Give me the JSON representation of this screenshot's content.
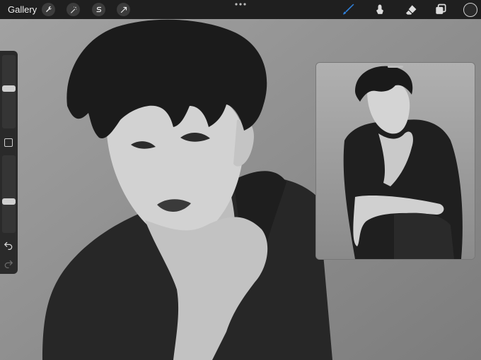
{
  "toolbar": {
    "gallery_label": "Gallery",
    "left_tools": [
      "wrench-icon",
      "magic-wand-icon",
      "selection-s-icon",
      "transform-arrow-icon"
    ],
    "right_tools": [
      "brush-icon",
      "smudge-icon",
      "eraser-icon",
      "layers-icon"
    ],
    "active_tool": "brush-icon",
    "accent_color": "#2f7fd8",
    "current_color": "#2a2a2a"
  },
  "sidebar": {
    "brush_size_level": 0.55,
    "opacity_level": 0.4,
    "icons": [
      "modifier-square-icon",
      "undo-icon",
      "redo-icon"
    ]
  },
  "canvas": {
    "background": "#8e8e8e",
    "jacket_color": "#262626",
    "hair_color": "#1b1b1b",
    "skin_color": "#cfcfcf"
  },
  "reference_window": {
    "background": "#9a9a9a"
  }
}
